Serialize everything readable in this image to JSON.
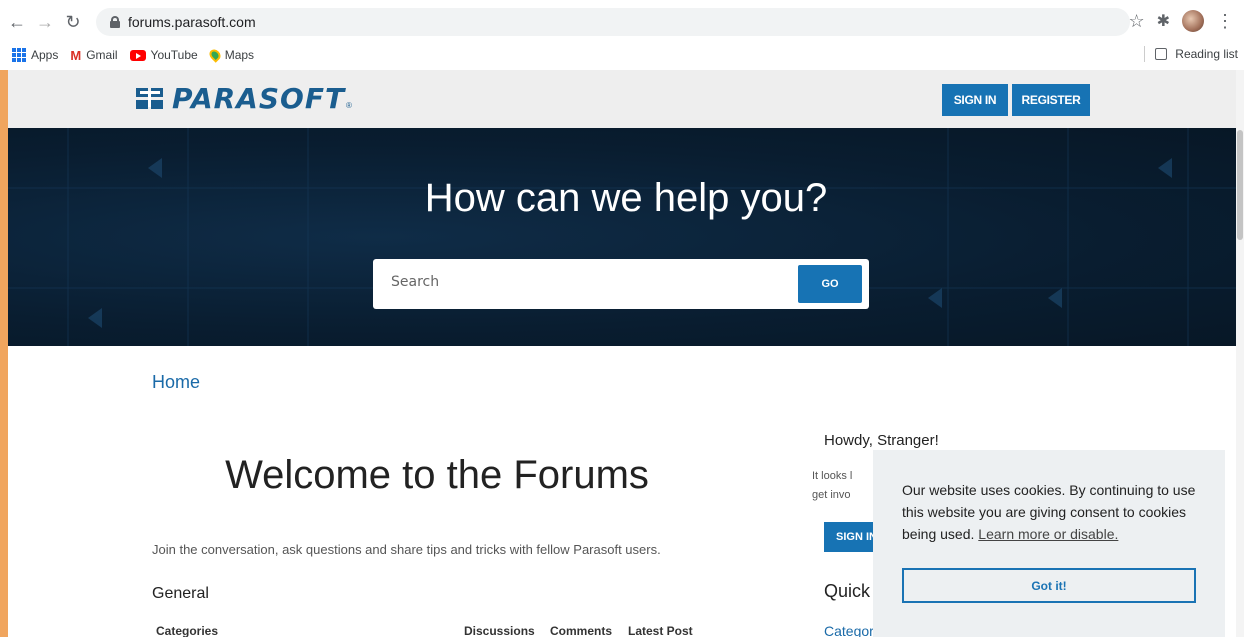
{
  "browser": {
    "url": "forums.parasoft.com",
    "bookmarks": [
      {
        "label": "Apps",
        "icon": "apps-grid-icon"
      },
      {
        "label": "Gmail",
        "icon": "gmail-icon"
      },
      {
        "label": "YouTube",
        "icon": "youtube-icon"
      },
      {
        "label": "Maps",
        "icon": "maps-icon"
      }
    ],
    "reading_list": "Reading list"
  },
  "header": {
    "logo_text": "PARASOFT",
    "sign_in": "SIGN IN",
    "register": "REGISTER",
    "colors": {
      "brand": "#1773b4",
      "logo": "#1a5d8f"
    }
  },
  "hero": {
    "title": "How can we help you?",
    "search_placeholder": "Search",
    "go_label": "GO"
  },
  "main": {
    "breadcrumb": "Home",
    "welcome": "Welcome to the Forums",
    "intro": "Join the conversation, ask questions and share tips and tricks with fellow Parasoft users.",
    "section": "General",
    "table_headers": [
      "Categories",
      "Discussions",
      "Comments",
      "Latest Post"
    ]
  },
  "sidebar": {
    "greeting": "Howdy, Stranger!",
    "looks_line1": "It looks l",
    "looks_line2": "get invo",
    "sign_in": "SIGN IN",
    "quick": "Quick",
    "categories_link": "Categories"
  },
  "cookie": {
    "text": "Our website uses cookies. By continuing to use this website you are giving consent to cookies being used.",
    "link": "Learn more or disable.",
    "button": "Got it!"
  }
}
